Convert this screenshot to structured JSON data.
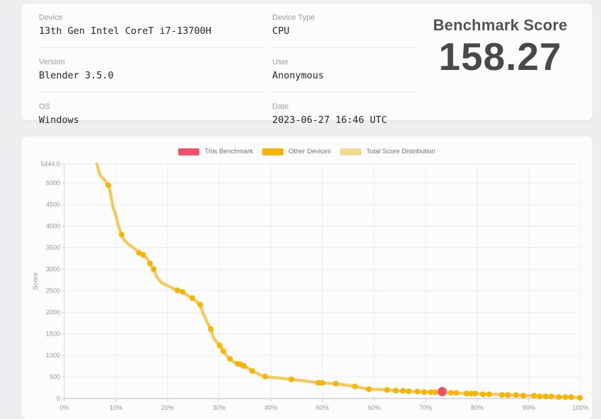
{
  "info": {
    "fields": [
      {
        "label": "Device",
        "value": "13th Gen Intel CoreT i7-13700H"
      },
      {
        "label": "Device Type",
        "value": "CPU"
      },
      {
        "label": "Version",
        "value": "Blender 3.5.0"
      },
      {
        "label": "User",
        "value": "Anonymous"
      },
      {
        "label": "OS",
        "value": "Windows"
      },
      {
        "label": "Date",
        "value": "2023-06-27 16:46 UTC"
      }
    ],
    "score_heading": "Benchmark Score",
    "score_value": "158.27"
  },
  "colors": {
    "benchmark_red": "#f0506a",
    "other_devices_amber": "#f7b500",
    "distribution_pale": "#f5d98c",
    "line_amber": "#f2c350",
    "grid": "#ececee",
    "axis": "#c9c9cf",
    "tick_text": "#96969c"
  },
  "chart_data": {
    "type": "line+scatter",
    "title": "",
    "xlabel": "",
    "ylabel": "Score",
    "xlim": [
      0,
      100
    ],
    "ylim": [
      0,
      5444
    ],
    "grid": true,
    "legend_position": "top-center",
    "x_ticks": [
      [
        0,
        "0%"
      ],
      [
        10,
        "10%"
      ],
      [
        20,
        "20%"
      ],
      [
        30,
        "30%"
      ],
      [
        40,
        "40%"
      ],
      [
        50,
        "50%"
      ],
      [
        60,
        "60%"
      ],
      [
        70,
        "70%"
      ],
      [
        80,
        "80%"
      ],
      [
        90,
        "90%"
      ],
      [
        100,
        "100%"
      ]
    ],
    "y_ticks": [
      [
        5444,
        "5444.0"
      ],
      [
        5000,
        "5000"
      ],
      [
        4500,
        "4500"
      ],
      [
        4000,
        "4000"
      ],
      [
        3500,
        "3500"
      ],
      [
        3000,
        "3000"
      ],
      [
        2500,
        "2500"
      ],
      [
        2000,
        "2000"
      ],
      [
        1500,
        "1500"
      ],
      [
        1000,
        "1000"
      ],
      [
        500,
        "500"
      ],
      [
        0,
        "0"
      ]
    ],
    "legend": [
      {
        "label": "This Benchmark",
        "color": "#f0506a"
      },
      {
        "label": "Other Devices",
        "color": "#f7b500"
      },
      {
        "label": "Total Score Distribution",
        "color": "#f5d98c"
      }
    ],
    "series": [
      {
        "name": "Total Score Distribution",
        "type": "line",
        "color": "#f2c350",
        "halo_color": "#f5d98c",
        "points": [
          [
            6.3,
            5444
          ],
          [
            6.6,
            5310
          ],
          [
            6.9,
            5180
          ],
          [
            7.8,
            5070
          ],
          [
            8.5,
            4950
          ],
          [
            8.9,
            4790
          ],
          [
            9.2,
            4580
          ],
          [
            9.5,
            4400
          ],
          [
            9.9,
            4300
          ],
          [
            10.3,
            4080
          ],
          [
            10.7,
            3920
          ],
          [
            11.1,
            3805
          ],
          [
            11.6,
            3675
          ],
          [
            12.5,
            3575
          ],
          [
            13.6,
            3480
          ],
          [
            14.5,
            3380
          ],
          [
            15.3,
            3330
          ],
          [
            16.0,
            3250
          ],
          [
            16.6,
            3130
          ],
          [
            17.3,
            3000
          ],
          [
            17.9,
            2820
          ],
          [
            18.8,
            2690
          ],
          [
            19.9,
            2625
          ],
          [
            21.0,
            2560
          ],
          [
            21.9,
            2510
          ],
          [
            22.9,
            2475
          ],
          [
            23.8,
            2395
          ],
          [
            24.8,
            2330
          ],
          [
            25.6,
            2250
          ],
          [
            26.3,
            2180
          ],
          [
            26.7,
            2030
          ],
          [
            27.3,
            1870
          ],
          [
            27.8,
            1740
          ],
          [
            28.4,
            1610
          ],
          [
            28.9,
            1410
          ],
          [
            29.5,
            1310
          ],
          [
            30.1,
            1230
          ],
          [
            30.8,
            1100
          ],
          [
            31.4,
            1000
          ],
          [
            32.1,
            920
          ],
          [
            32.7,
            855
          ],
          [
            33.6,
            805
          ],
          [
            34.2,
            790
          ],
          [
            34.8,
            755
          ],
          [
            35.8,
            690
          ],
          [
            36.4,
            640
          ],
          [
            37.3,
            590
          ],
          [
            38.1,
            540
          ],
          [
            38.9,
            510
          ],
          [
            40.3,
            490
          ],
          [
            41.6,
            475
          ],
          [
            44.0,
            445
          ],
          [
            46.4,
            410
          ],
          [
            49.2,
            365
          ],
          [
            50.0,
            360
          ],
          [
            52.6,
            345
          ],
          [
            54.7,
            310
          ],
          [
            56.3,
            280
          ],
          [
            59.0,
            215
          ],
          [
            60.8,
            212
          ],
          [
            62.5,
            198
          ],
          [
            64.2,
            182
          ],
          [
            66.7,
            165
          ],
          [
            68.4,
            163
          ],
          [
            69.7,
            150
          ],
          [
            71.8,
            147
          ],
          [
            73.2,
            140
          ],
          [
            74.9,
            132
          ],
          [
            77.9,
            116
          ],
          [
            79.6,
            114
          ],
          [
            81.1,
            99
          ],
          [
            83.4,
            97
          ],
          [
            85.9,
            82
          ],
          [
            87.5,
            81
          ],
          [
            88.9,
            67
          ],
          [
            91.0,
            65
          ],
          [
            93.3,
            49
          ],
          [
            95.8,
            34
          ],
          [
            98.2,
            32
          ],
          [
            99.9,
            17
          ]
        ]
      },
      {
        "name": "Other Devices",
        "type": "scatter",
        "color": "#f7b500",
        "points": [
          [
            8.5,
            4950
          ],
          [
            11.1,
            3805
          ],
          [
            14.5,
            3380
          ],
          [
            15.3,
            3330
          ],
          [
            16.6,
            3130
          ],
          [
            17.3,
            3000
          ],
          [
            21.9,
            2510
          ],
          [
            22.9,
            2475
          ],
          [
            24.8,
            2330
          ],
          [
            26.3,
            2180
          ],
          [
            28.4,
            1610
          ],
          [
            30.1,
            1230
          ],
          [
            30.8,
            1100
          ],
          [
            32.1,
            920
          ],
          [
            33.6,
            805
          ],
          [
            34.2,
            790
          ],
          [
            34.8,
            755
          ],
          [
            36.4,
            640
          ],
          [
            38.9,
            510
          ],
          [
            44.0,
            445
          ],
          [
            49.2,
            365
          ],
          [
            50.0,
            360
          ],
          [
            52.6,
            345
          ],
          [
            56.3,
            280
          ],
          [
            59.0,
            215
          ],
          [
            62.5,
            198
          ],
          [
            64.2,
            182
          ],
          [
            65.6,
            180
          ],
          [
            66.7,
            165
          ],
          [
            68.4,
            163
          ],
          [
            69.7,
            150
          ],
          [
            71.0,
            148
          ],
          [
            71.8,
            147
          ],
          [
            74.9,
            132
          ],
          [
            75.9,
            130
          ],
          [
            77.9,
            116
          ],
          [
            78.8,
            115
          ],
          [
            79.6,
            114
          ],
          [
            81.1,
            99
          ],
          [
            82.3,
            98
          ],
          [
            84.8,
            83
          ],
          [
            85.9,
            82
          ],
          [
            87.5,
            81
          ],
          [
            88.9,
            67
          ],
          [
            91.0,
            65
          ],
          [
            92.1,
            50
          ],
          [
            93.3,
            49
          ],
          [
            94.4,
            48
          ],
          [
            95.8,
            34
          ],
          [
            97.1,
            33
          ],
          [
            98.2,
            32
          ],
          [
            99.9,
            17
          ]
        ]
      },
      {
        "name": "This Benchmark",
        "type": "scatter",
        "color": "#f0506a",
        "points": [
          [
            73.2,
            158.27
          ]
        ]
      }
    ]
  }
}
